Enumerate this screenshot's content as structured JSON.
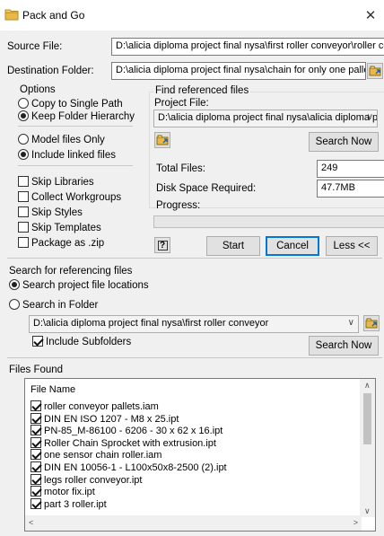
{
  "window": {
    "title": "Pack and Go",
    "close_glyph": "✕"
  },
  "source": {
    "label": "Source File:",
    "value": "D:\\alicia diploma project final nysa\\first roller conveyor\\roller conveyor"
  },
  "destination": {
    "label": "Destination Folder:",
    "value": "D:\\alicia diploma project final nysa\\chain for only one pallet"
  },
  "options": {
    "title": "Options",
    "copy_single_path": "Copy to Single Path",
    "keep_folder_hierarchy": "Keep Folder Hierarchy",
    "model_files_only": "Model files Only",
    "include_linked_files": "Include linked files",
    "skip_libraries": "Skip Libraries",
    "collect_workgroups": "Collect Workgroups",
    "skip_styles": "Skip Styles",
    "skip_templates": "Skip Templates",
    "package_as_zip": "Package as .zip"
  },
  "find_refs": {
    "title": "Find referenced files",
    "project_file_label": "Project File:",
    "project_file_value": "D:\\alicia diploma project final nysa\\alicia diploma projec",
    "search_now": "Search Now",
    "total_files_label": "Total Files:",
    "total_files_value": "249",
    "disk_space_label": "Disk Space Required:",
    "disk_space_value": "47.7MB",
    "progress_label": "Progress:",
    "progress_fraction": 0
  },
  "actions": {
    "help": "?",
    "start": "Start",
    "cancel": "Cancel",
    "less": "Less <<"
  },
  "search_referencing": {
    "title": "Search for referencing files",
    "search_project_locations": "Search project file locations",
    "search_in_folder": "Search in Folder",
    "folder_value": "D:\\alicia diploma project final nysa\\first roller conveyor",
    "include_subfolders": "Include Subfolders",
    "search_now": "Search Now"
  },
  "files_found": {
    "title": "Files Found",
    "column_header": "File Name",
    "items": [
      "roller conveyor pallets.iam",
      "DIN EN ISO 1207 - M8 x 25.ipt",
      "PN-85_M-86100 - 6206 - 30 x 62 x 16.ipt",
      "Roller Chain Sprocket with extrusion.ipt",
      "one sensor chain roller.iam",
      "DIN EN 10056-1 - L100x50x8-2500 (2).ipt",
      "legs roller conveyor.ipt",
      "motor fix.ipt",
      "part 3 roller.ipt"
    ]
  },
  "colors": {
    "background": "#f0f0f0",
    "accent": "#0078d7",
    "folder_icon": "#e8b84a"
  }
}
